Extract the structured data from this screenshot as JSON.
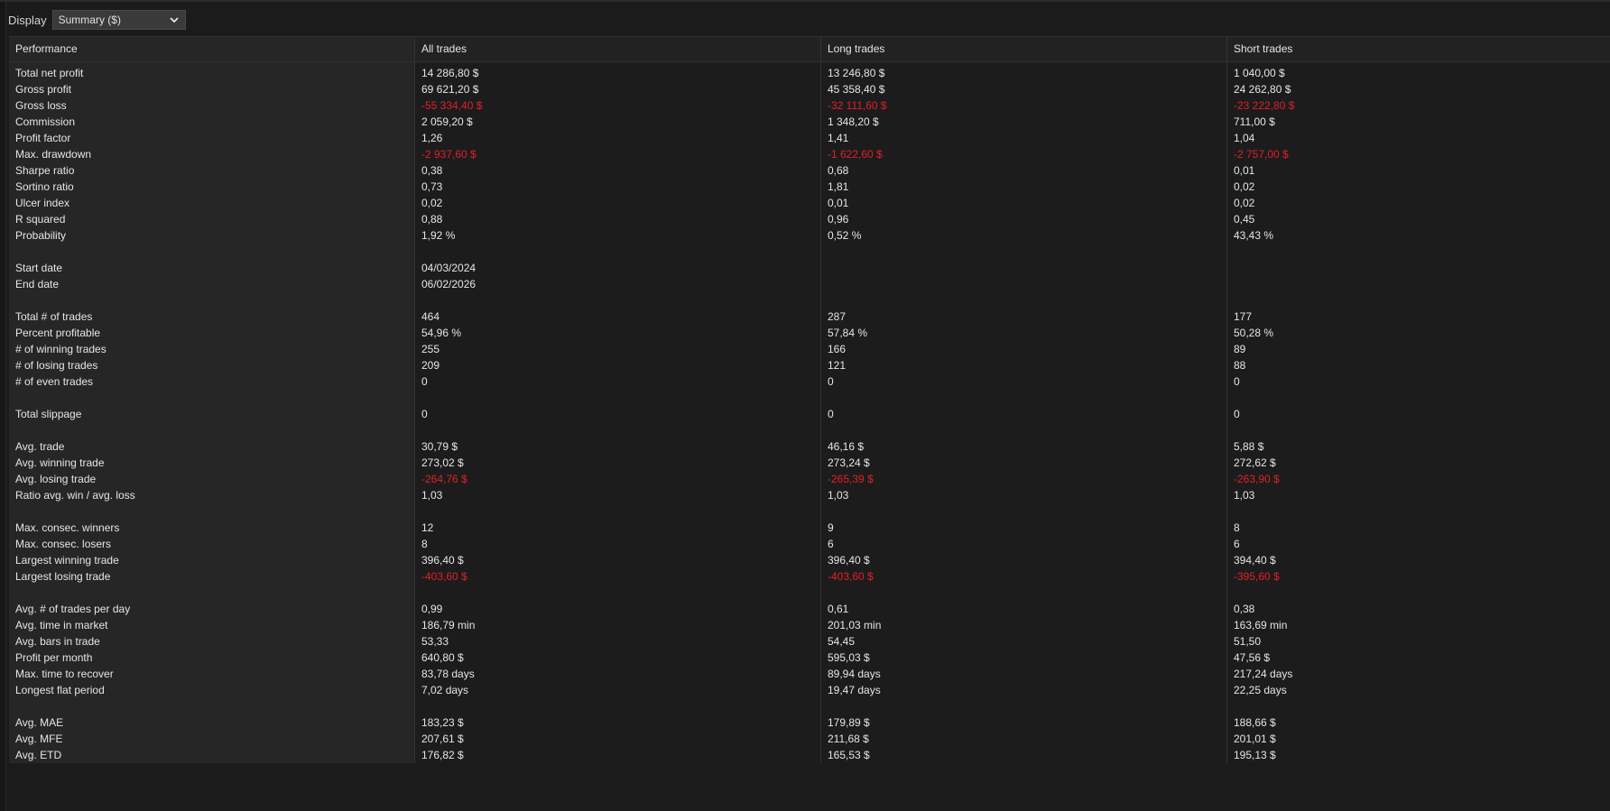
{
  "toolbar": {
    "display_label": "Display",
    "display_value": "Summary ($)"
  },
  "table": {
    "columns": [
      "Performance",
      "All trades",
      "Long trades",
      "Short trades"
    ],
    "rows": [
      {
        "label": "Total net profit",
        "values": [
          "14 286,80 $",
          "13 246,80 $",
          "1 040,00 $"
        ],
        "negative": false
      },
      {
        "label": "Gross profit",
        "values": [
          "69 621,20 $",
          "45 358,40 $",
          "24 262,80 $"
        ],
        "negative": false
      },
      {
        "label": "Gross loss",
        "values": [
          "-55 334,40 $",
          "-32 111,60 $",
          "-23 222,80 $"
        ],
        "negative": true
      },
      {
        "label": "Commission",
        "values": [
          "2 059,20 $",
          "1 348,20 $",
          "711,00 $"
        ],
        "negative": false
      },
      {
        "label": "Profit factor",
        "values": [
          "1,26",
          "1,41",
          "1,04"
        ],
        "negative": false
      },
      {
        "label": "Max. drawdown",
        "values": [
          "-2 937,60 $",
          "-1 622,60 $",
          "-2 757,00 $"
        ],
        "negative": true
      },
      {
        "label": "Sharpe ratio",
        "values": [
          "0,38",
          "0,68",
          "0,01"
        ],
        "negative": false
      },
      {
        "label": "Sortino ratio",
        "values": [
          "0,73",
          "1,81",
          "0,02"
        ],
        "negative": false
      },
      {
        "label": "Ulcer index",
        "values": [
          "0,02",
          "0,01",
          "0,02"
        ],
        "negative": false
      },
      {
        "label": "R squared",
        "values": [
          "0,88",
          "0,96",
          "0,45"
        ],
        "negative": false
      },
      {
        "label": "Probability",
        "values": [
          "1,92 %",
          "0,52 %",
          "43,43 %"
        ],
        "negative": false
      },
      {
        "spacer": true
      },
      {
        "label": "Start date",
        "values": [
          "04/03/2024",
          "",
          ""
        ],
        "negative": false
      },
      {
        "label": "End date",
        "values": [
          "06/02/2026",
          "",
          ""
        ],
        "negative": false
      },
      {
        "spacer": true
      },
      {
        "label": "Total # of trades",
        "values": [
          "464",
          "287",
          "177"
        ],
        "negative": false
      },
      {
        "label": "Percent profitable",
        "values": [
          "54,96 %",
          "57,84 %",
          "50,28 %"
        ],
        "negative": false
      },
      {
        "label": "# of winning trades",
        "values": [
          "255",
          "166",
          "89"
        ],
        "negative": false
      },
      {
        "label": "# of losing trades",
        "values": [
          "209",
          "121",
          "88"
        ],
        "negative": false
      },
      {
        "label": "# of even trades",
        "values": [
          "0",
          "0",
          "0"
        ],
        "negative": false
      },
      {
        "spacer": true
      },
      {
        "label": "Total slippage",
        "values": [
          "0",
          "0",
          "0"
        ],
        "negative": false
      },
      {
        "spacer": true
      },
      {
        "label": "Avg. trade",
        "values": [
          "30,79 $",
          "46,16 $",
          "5,88 $"
        ],
        "negative": false
      },
      {
        "label": "Avg. winning trade",
        "values": [
          "273,02 $",
          "273,24 $",
          "272,62 $"
        ],
        "negative": false
      },
      {
        "label": "Avg. losing trade",
        "values": [
          "-264,76 $",
          "-265,39 $",
          "-263,90 $"
        ],
        "negative": true
      },
      {
        "label": "Ratio avg. win / avg. loss",
        "values": [
          "1,03",
          "1,03",
          "1,03"
        ],
        "negative": false
      },
      {
        "spacer": true
      },
      {
        "label": "Max. consec. winners",
        "values": [
          "12",
          "9",
          "8"
        ],
        "negative": false
      },
      {
        "label": "Max. consec. losers",
        "values": [
          "8",
          "6",
          "6"
        ],
        "negative": false
      },
      {
        "label": "Largest winning trade",
        "values": [
          "396,40 $",
          "396,40 $",
          "394,40 $"
        ],
        "negative": false
      },
      {
        "label": "Largest losing trade",
        "values": [
          "-403,60 $",
          "-403,60 $",
          "-395,60 $"
        ],
        "negative": true
      },
      {
        "spacer": true
      },
      {
        "label": "Avg. # of trades per day",
        "values": [
          "0,99",
          "0,61",
          "0,38"
        ],
        "negative": false
      },
      {
        "label": "Avg. time in market",
        "values": [
          "186,79 min",
          "201,03 min",
          "163,69 min"
        ],
        "negative": false
      },
      {
        "label": "Avg. bars in trade",
        "values": [
          "53,33",
          "54,45",
          "51,50"
        ],
        "negative": false
      },
      {
        "label": "Profit per month",
        "values": [
          "640,80 $",
          "595,03 $",
          "47,56 $"
        ],
        "negative": false
      },
      {
        "label": "Max. time to recover",
        "values": [
          "83,78 days",
          "89,94 days",
          "217,24 days"
        ],
        "negative": false
      },
      {
        "label": "Longest flat period",
        "values": [
          "7,02 days",
          "19,47 days",
          "22,25 days"
        ],
        "negative": false
      },
      {
        "spacer": true
      },
      {
        "label": "Avg. MAE",
        "values": [
          "183,23 $",
          "179,89 $",
          "188,66 $"
        ],
        "negative": false
      },
      {
        "label": "Avg. MFE",
        "values": [
          "207,61 $",
          "211,68 $",
          "201,01 $"
        ],
        "negative": false
      },
      {
        "label": "Avg. ETD",
        "values": [
          "176,82 $",
          "165,53 $",
          "195,13 $"
        ],
        "negative": false
      }
    ]
  },
  "colors": {
    "background": "#1b1b1b",
    "text": "#e6e6e6",
    "negative": "#e0202a"
  }
}
